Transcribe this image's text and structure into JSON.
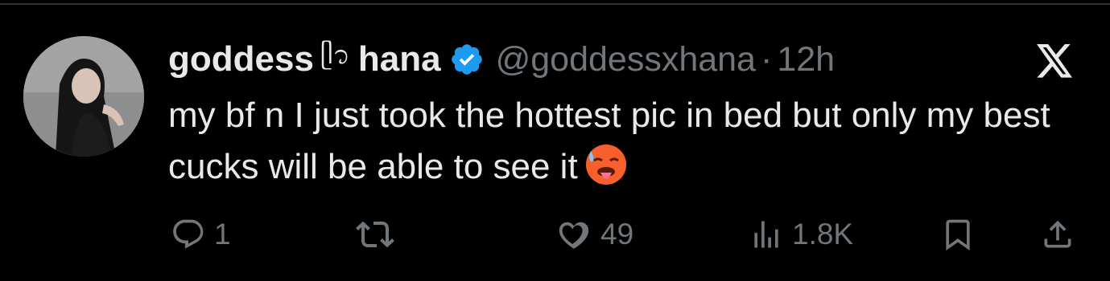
{
  "tweet": {
    "display_name_part1": "goddess",
    "display_name_symbol": "ᥫ᭡",
    "display_name_part2": "hana",
    "handle": "@goddessxhana",
    "separator": "·",
    "time": "12h",
    "text": "my bf n I just took the hottest pic in bed but only my best cucks will be able to see it",
    "emoji": "hot-face-emoji"
  },
  "actions": {
    "replies": "1",
    "retweets": "",
    "likes": "49",
    "views": "1.8K"
  },
  "colors": {
    "background": "#000000",
    "primary_text": "#e7e9ea",
    "secondary_text": "#71767b",
    "verified_blue": "#1d9bf0"
  }
}
